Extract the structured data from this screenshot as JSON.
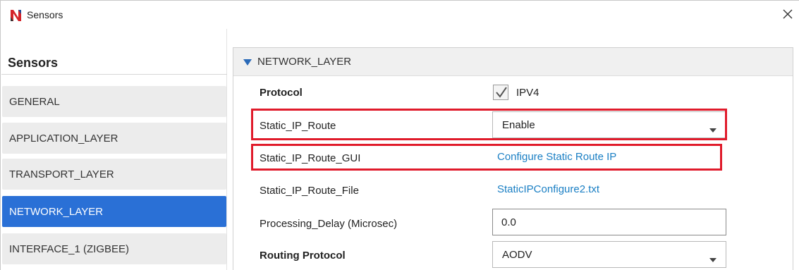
{
  "window": {
    "title": "Sensors",
    "app_icon": "netsim-logo-icon",
    "close_icon": "close-icon"
  },
  "sidebar": {
    "heading": "Sensors",
    "items": [
      {
        "label": "GENERAL",
        "active": false
      },
      {
        "label": "APPLICATION_LAYER",
        "active": false
      },
      {
        "label": "TRANSPORT_LAYER",
        "active": false
      },
      {
        "label": "NETWORK_LAYER",
        "active": true
      },
      {
        "label": "INTERFACE_1 (ZIGBEE)",
        "active": false
      }
    ]
  },
  "section": {
    "title": "NETWORK_LAYER",
    "expanded": true,
    "icon": "triangle-down-icon"
  },
  "properties": {
    "protocol": {
      "label": "Protocol",
      "checked": true,
      "value": "IPV4"
    },
    "static_ip_route": {
      "label": "Static_IP_Route",
      "value": "Enable"
    },
    "static_ip_route_gui": {
      "label": "Static_IP_Route_GUI",
      "link": "Configure Static Route IP"
    },
    "static_ip_route_file": {
      "label": "Static_IP_Route_File",
      "link": "StaticIPConfigure2.txt"
    },
    "processing_delay": {
      "label": "Processing_Delay (Microsec)",
      "value": "0.0"
    },
    "routing_protocol": {
      "label": "Routing Protocol",
      "value": "AODV"
    }
  },
  "colors": {
    "accent": "#2a70d6",
    "highlight": "#e01b2b",
    "link": "#1a7fc4",
    "section_arrow": "#2a6ab8"
  }
}
